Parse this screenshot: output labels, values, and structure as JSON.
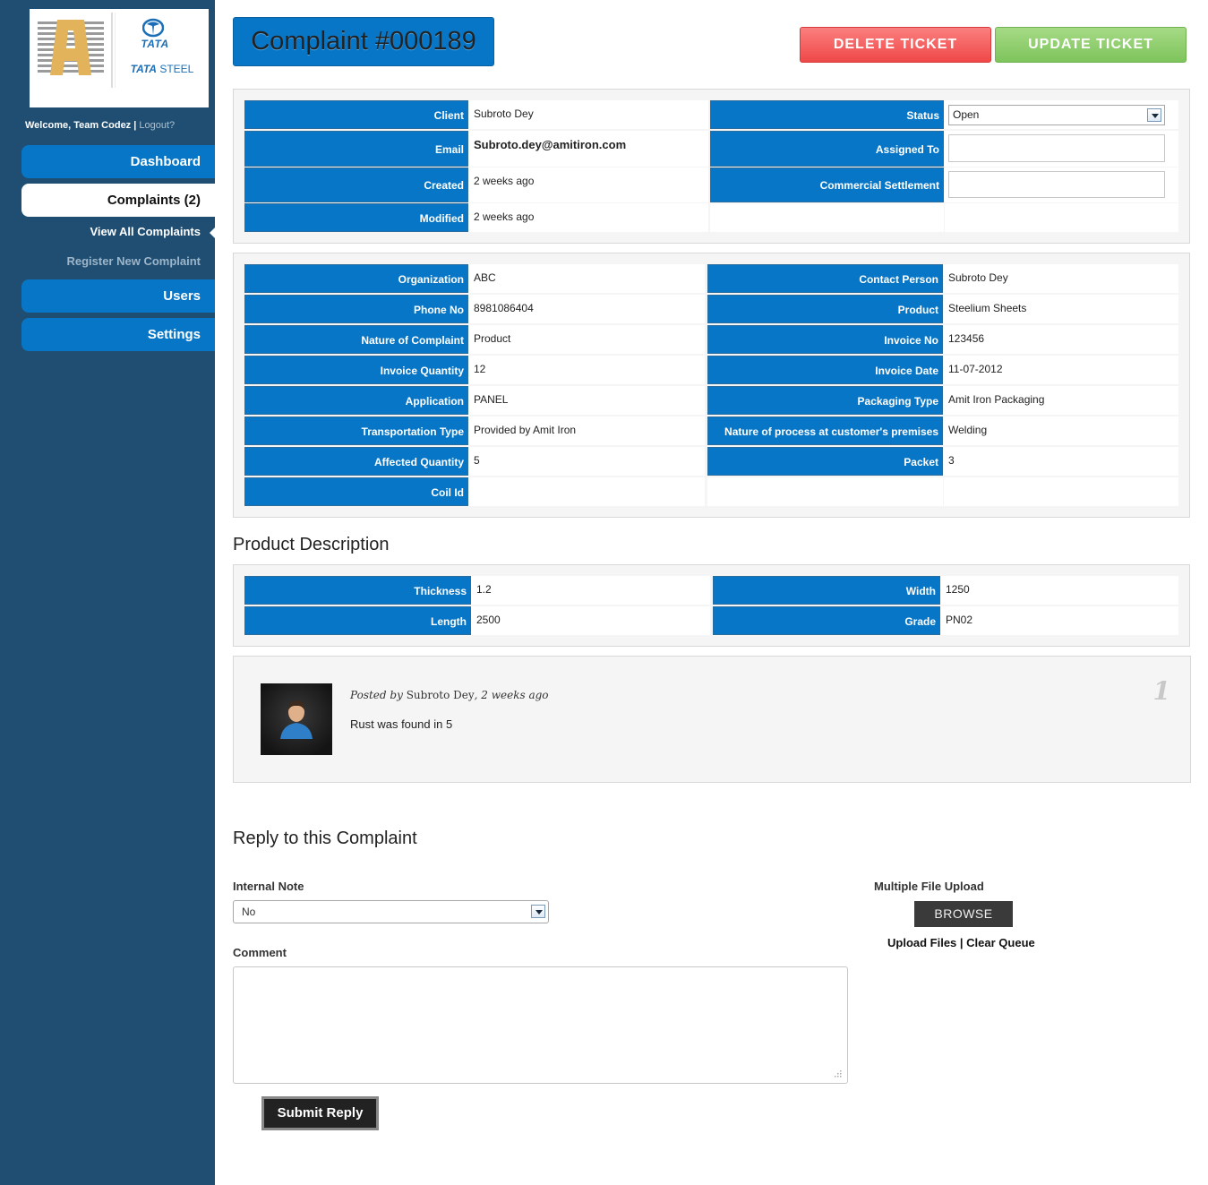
{
  "sidebar": {
    "logo": {
      "brand": "TATA",
      "steel_prefix": "TATA",
      "steel_suffix": "STEEL"
    },
    "welcome": "Welcome, Team Codez |",
    "logout": "Logout?",
    "nav": {
      "dashboard": "Dashboard",
      "complaints": "Complaints (2)",
      "view_all": "View All Complaints",
      "register": "Register New Complaint",
      "users": "Users",
      "settings": "Settings"
    }
  },
  "header": {
    "title": "Complaint #000189",
    "delete_label": "DELETE TICKET",
    "update_label": "UPDATE TICKET"
  },
  "ticket": {
    "client_label": "Client",
    "client": "Subroto Dey",
    "email_label": "Email",
    "email": "Subroto.dey@amitiron.com",
    "created_label": "Created",
    "created": "2 weeks ago",
    "modified_label": "Modified",
    "modified": "2 weeks ago",
    "status_label": "Status",
    "status": "Open",
    "assigned_label": "Assigned To",
    "assigned": "",
    "settlement_label": "Commercial Settlement",
    "settlement": ""
  },
  "details": {
    "organization_label": "Organization",
    "organization": "ABC",
    "phone_label": "Phone No",
    "phone": "8981086404",
    "nature_label": "Nature of Complaint",
    "nature": "Product",
    "invoice_qty_label": "Invoice Quantity",
    "invoice_qty": "12",
    "application_label": "Application",
    "application": "PANEL",
    "transport_label": "Transportation Type",
    "transport": "Provided by Amit Iron",
    "affected_label": "Affected Quantity",
    "affected": "5",
    "coil_label": "Coil Id",
    "coil": "",
    "contact_label": "Contact Person",
    "contact": "Subroto Dey",
    "product_label": "Product",
    "product": "Steelium Sheets",
    "invoice_no_label": "Invoice No",
    "invoice_no": "123456",
    "invoice_date_label": "Invoice Date",
    "invoice_date": "11-07-2012",
    "packaging_label": "Packaging Type",
    "packaging": "Amit Iron Packaging",
    "process_label": "Nature of process at customer's premises",
    "process": "Welding",
    "packet_label": "Packet",
    "packet": "3"
  },
  "product_description": {
    "heading": "Product Description",
    "thickness_label": "Thickness",
    "thickness": "1.2",
    "length_label": "Length",
    "length": "2500",
    "width_label": "Width",
    "width": "1250",
    "grade_label": "Grade",
    "grade": "PN02"
  },
  "comment": {
    "posted_by": "Posted by",
    "author": "Subroto Dey",
    "when": ", 2 weeks ago",
    "text": "Rust was found in 5",
    "number": "1"
  },
  "reply": {
    "heading": "Reply to this Complaint",
    "internal_note_label": "Internal Note",
    "internal_note_value": "No",
    "comment_label": "Comment",
    "upload_label": "Multiple File Upload",
    "browse_label": "BROWSE",
    "upload_files": "Upload Files",
    "separator": " | ",
    "clear_queue": "Clear Queue",
    "submit_label": "Submit Reply"
  },
  "colors": {
    "sidebar_bg": "#1f4e72",
    "accent_blue": "#0876c6",
    "delete_red": "#ef4848",
    "update_green": "#7ec45c"
  }
}
